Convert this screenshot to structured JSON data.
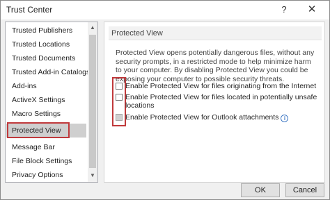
{
  "window": {
    "title": "Trust Center",
    "help_glyph": "?",
    "close_glyph": "✕"
  },
  "sidebar": {
    "items": [
      {
        "label": "Trusted Publishers"
      },
      {
        "label": "Trusted Locations"
      },
      {
        "label": "Trusted Documents"
      },
      {
        "label": "Trusted Add-in Catalogs"
      },
      {
        "label": "Add-ins"
      },
      {
        "label": "ActiveX Settings"
      },
      {
        "label": "Macro Settings"
      },
      {
        "label": "Protected View",
        "selected": true
      },
      {
        "label": "Message Bar"
      },
      {
        "label": "File Block Settings"
      },
      {
        "label": "Privacy Options"
      }
    ],
    "scroll_up_glyph": "▲",
    "scroll_down_glyph": "▼"
  },
  "main": {
    "section_title": "Protected View",
    "description": "Protected View opens potentially dangerous files, without any security prompts, in a restricted mode to help minimize harm to your computer. By disabling Protected View you could be exposing your computer to possible security threats.",
    "options": [
      {
        "label": "Enable Protected View for files originating from the Internet",
        "checked": false,
        "enabled": true
      },
      {
        "label": "Enable Protected View for files located in potentially unsafe locations",
        "checked": false,
        "enabled": true
      },
      {
        "label": "Enable Protected View for Outlook attachments",
        "checked": false,
        "enabled": false
      }
    ],
    "info_glyph": "i"
  },
  "buttons": {
    "ok": "OK",
    "cancel": "Cancel"
  },
  "colors": {
    "annotation_red": "#c0393b",
    "selected_bg": "#cfcfcf",
    "info_blue": "#3f78c4"
  }
}
